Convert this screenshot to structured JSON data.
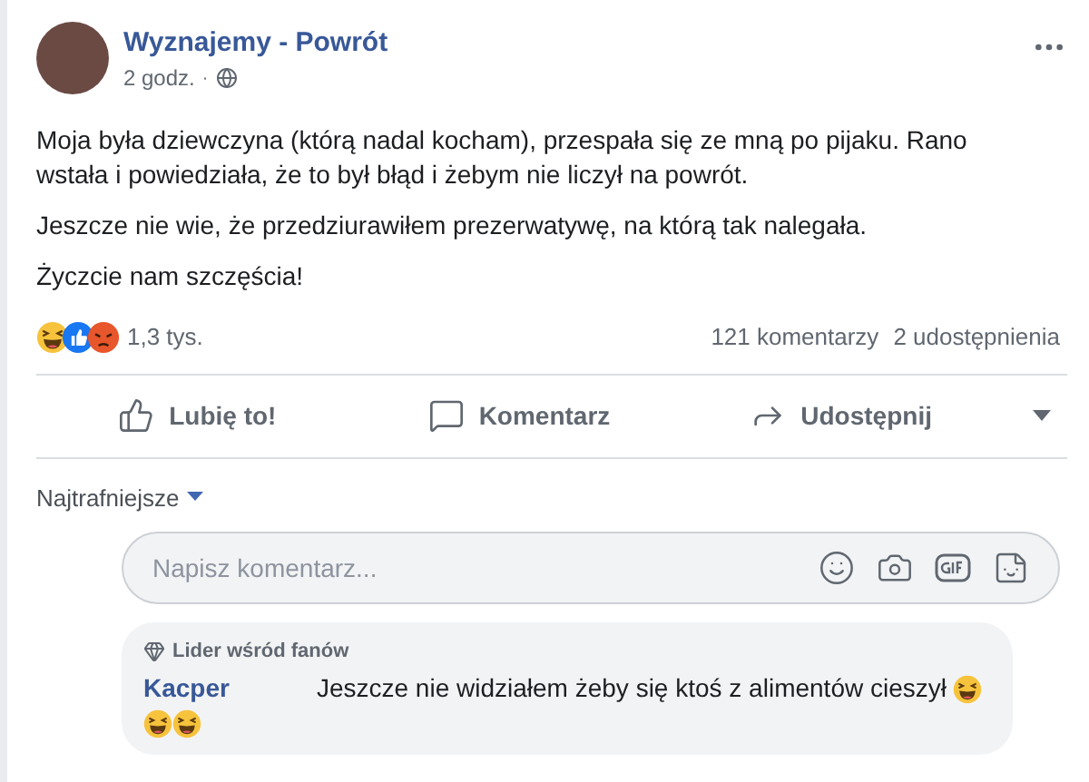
{
  "post": {
    "author": "Wyznajemy - Powrót",
    "time": "2 godz.",
    "separator": "·",
    "paragraphs": [
      "Moja była dziewczyna (którą nadal kocham), przespała się ze mną po pijaku. Rano wstała i powiedziała, że to był błąd i żebym nie liczył na powrót.",
      "Jeszcze nie wie, że przedziurawiłem prezerwatywę, na którą tak nalegała.",
      "Życzcie nam szczęścia!"
    ]
  },
  "stats": {
    "reactions": [
      {
        "kind": "haha"
      },
      {
        "kind": "like"
      },
      {
        "kind": "angry"
      }
    ],
    "reaction_count": "1,3 tys.",
    "comments": "121 komentarzy",
    "shares": "2 udostępnienia"
  },
  "actions": [
    {
      "kind": "like",
      "label": "Lubię to!"
    },
    {
      "kind": "comment",
      "label": "Komentarz"
    },
    {
      "kind": "share",
      "label": "Udostępnij"
    }
  ],
  "sort": {
    "label": "Najtrafniejsze"
  },
  "comment_field": {
    "placeholder": "Napisz komentarz..."
  },
  "comments": [
    {
      "badge": "Lider wśród fanów",
      "author": "Kacper",
      "text": "Jeszcze nie widziałem żeby się ktoś z alimentów cieszył",
      "emojis": [
        {
          "kind": "laugh"
        },
        {
          "kind": "laugh"
        },
        {
          "kind": "laugh"
        }
      ]
    }
  ]
}
